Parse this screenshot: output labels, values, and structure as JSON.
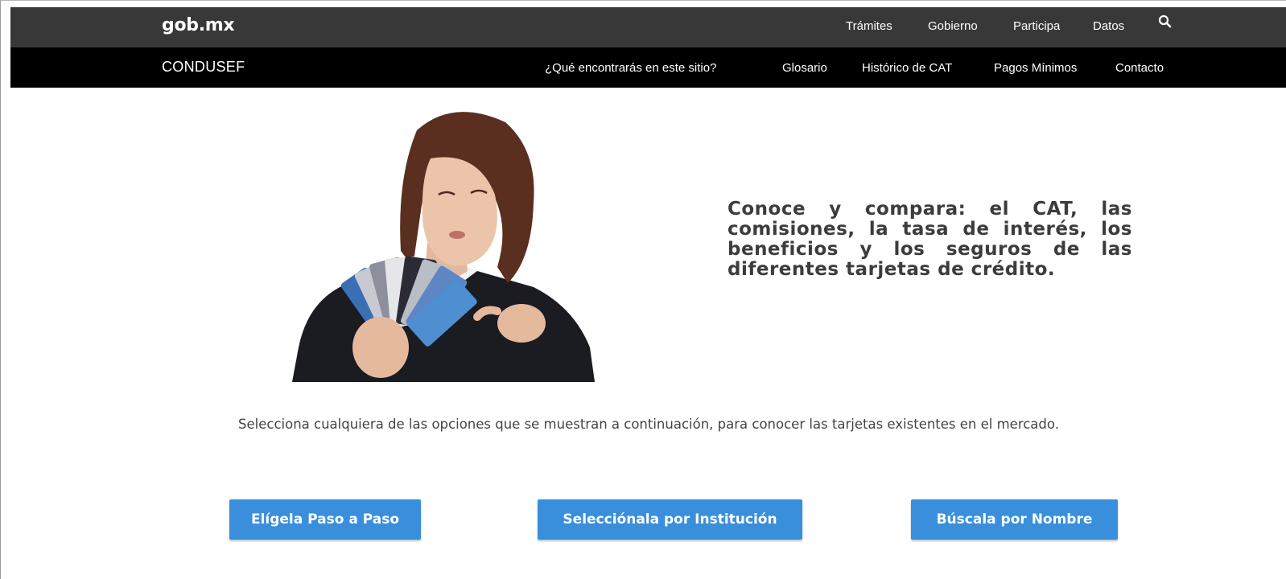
{
  "gob_bar": {
    "logo": "gob.mx",
    "nav": [
      "Trámites",
      "Gobierno",
      "Participa",
      "Datos"
    ],
    "search_icon": "search-icon"
  },
  "condusef_bar": {
    "title": "CONDUSEF",
    "nav": [
      "¿Qué encontrarás en este sitio?",
      "Glosario",
      "Histórico de CAT",
      "Pagos Mínimos",
      "Contacto"
    ]
  },
  "hero": {
    "image": "woman-holding-credit-cards-photo",
    "text": "Conoce y compara: el CAT, las comisiones, la tasa de interés, los beneficios y los seguros de las diferentes tarjetas de crédito."
  },
  "instructions": "Selecciona cualquiera de las opciones que se muestran a continuación, para conocer las tarjetas existentes en el mercado.",
  "buttons": [
    "Elígela Paso a Paso",
    "Selecciónala por Institución",
    "Búscala por Nombre"
  ],
  "colors": {
    "gob_bar": "#383838",
    "condusef_bar": "#000000",
    "button": "#3a8fdc",
    "hero_text": "#3c3c3c"
  }
}
